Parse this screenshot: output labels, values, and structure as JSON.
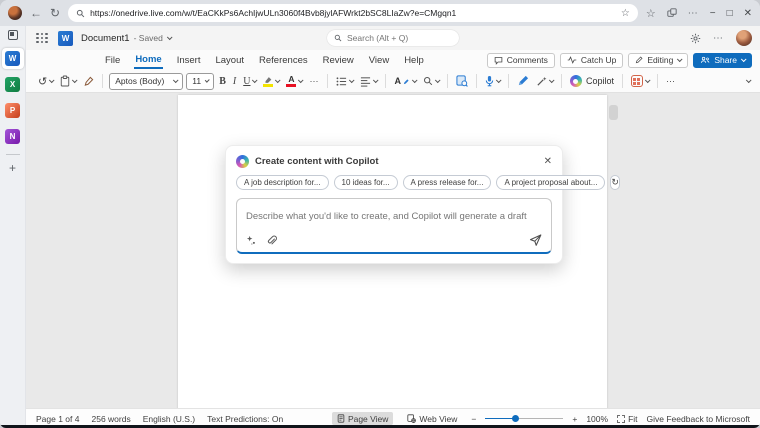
{
  "browser": {
    "url": "https://onedrive.live.com/w/t/EaCKkPs6AchIjwULn3060f4Bvb8jylAFWrkt2bSC8LIaZw?e=CMgqn1"
  },
  "sidebar": {
    "app_tiles": [
      {
        "name": "Word",
        "letter": "W"
      },
      {
        "name": "Excel",
        "letter": "X"
      },
      {
        "name": "PowerPoint",
        "letter": "P"
      },
      {
        "name": "OneNote",
        "letter": "N"
      }
    ]
  },
  "titlebar": {
    "doc_name": "Document1",
    "save_status": "- Saved",
    "search_placeholder": "Search (Alt + Q)"
  },
  "menubar": {
    "items": [
      "File",
      "Home",
      "Insert",
      "Layout",
      "References",
      "Review",
      "View",
      "Help"
    ],
    "active_item": "Home",
    "comments_label": "Comments",
    "catchup_label": "Catch Up",
    "editing_label": "Editing",
    "share_label": "Share"
  },
  "ribbon": {
    "font_name": "Aptos (Body)",
    "font_size": "11",
    "bold_label": "B",
    "italic_label": "I",
    "underline_label": "U",
    "font_color_letter": "A",
    "styles_letter": "A",
    "copilot_label": "Copilot"
  },
  "copilot_dialog": {
    "title": "Create content with Copilot",
    "suggestions": [
      "A job description for...",
      "10 ideas for...",
      "A press release for...",
      "A project proposal about..."
    ],
    "input_placeholder": "Describe what you'd like to create, and Copilot will generate a draft"
  },
  "statusbar": {
    "page_indicator": "Page 1 of 4",
    "word_count": "256 words",
    "language": "English (U.S.)",
    "text_predictions": "Text Predictions: On",
    "page_view_label": "Page View",
    "web_view_label": "Web View",
    "zoom_level": "100%",
    "fit_label": "Fit",
    "feedback_label": "Give Feedback to Microsoft"
  },
  "colors": {
    "word_blue": "#185abd",
    "accent_blue": "#0f6cbd",
    "excel_green": "#107c41",
    "powerpoint_orange": "#c43e1c",
    "onenote_purple": "#7719aa",
    "designer_orange": "#e0705a",
    "highlight_yellow": "#f3e400",
    "font_color_red": "#e81123"
  }
}
